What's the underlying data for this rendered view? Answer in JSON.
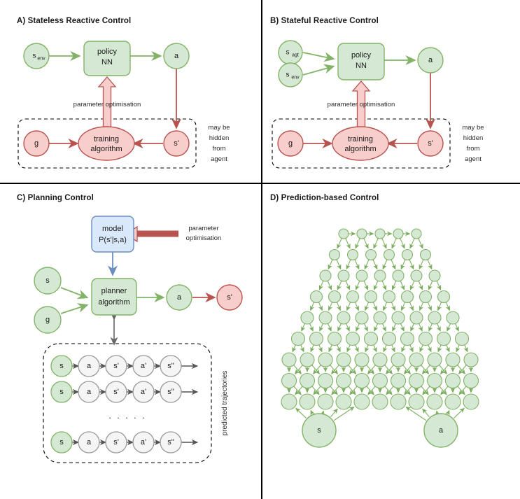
{
  "panels": {
    "a": {
      "title": "A) Stateless Reactive Control",
      "nodes": {
        "s_env": {
          "base": "s",
          "sub": "env"
        },
        "policy": {
          "line1": "policy",
          "line2": "NN"
        },
        "action": "a",
        "goal": "g",
        "training": {
          "line1": "training",
          "line2": "algorithm"
        },
        "next_state": "s'"
      },
      "edge_label": "parameter optimisation",
      "group_label": [
        "may be",
        "hidden",
        "from",
        "agent"
      ]
    },
    "b": {
      "title": "B) Stateful Reactive Control",
      "nodes": {
        "s_agt": {
          "base": "s",
          "sub": "agt"
        },
        "s_env": {
          "base": "s",
          "sub": "env"
        },
        "policy": {
          "line1": "policy",
          "line2": "NN"
        },
        "action": "a",
        "goal": "g",
        "training": {
          "line1": "training",
          "line2": "algorithm"
        },
        "next_state": "s'"
      },
      "edge_label": "parameter optimisation",
      "group_label": [
        "may be",
        "hidden",
        "from",
        "agent"
      ]
    },
    "c": {
      "title": "C) Planning Control",
      "nodes": {
        "model": {
          "line1": "model",
          "line2": "P(s'|s,a)"
        },
        "state": "s",
        "goal": "g",
        "planner": {
          "line1": "planner",
          "line2": "algorithm"
        },
        "action": "a",
        "next_state": "s'"
      },
      "edge_label": [
        "parameter",
        "optimisation"
      ],
      "group_label": "predicted trajectories",
      "trajectory_sequence": [
        "s",
        "a",
        "s'",
        "a'",
        "s\""
      ],
      "trajectory_rows": 3,
      "ellipsis": "· · · · ·"
    },
    "d": {
      "title": "D) Prediction-based Control",
      "nodes": {
        "state": "s",
        "action": "a"
      },
      "lattice": {
        "rows": 9,
        "top_row_count": 5,
        "bottom_row_count": 11
      }
    }
  },
  "colors": {
    "green_fill": "#d5e8d4",
    "green_stroke": "#82b366",
    "red_fill": "#f8cecc",
    "red_stroke": "#b85450",
    "blue_fill": "#dae8fc",
    "blue_stroke": "#6c8ebf",
    "gray_fill": "#f5f5f5",
    "gray_stroke": "#999999",
    "divider": "#000000"
  }
}
